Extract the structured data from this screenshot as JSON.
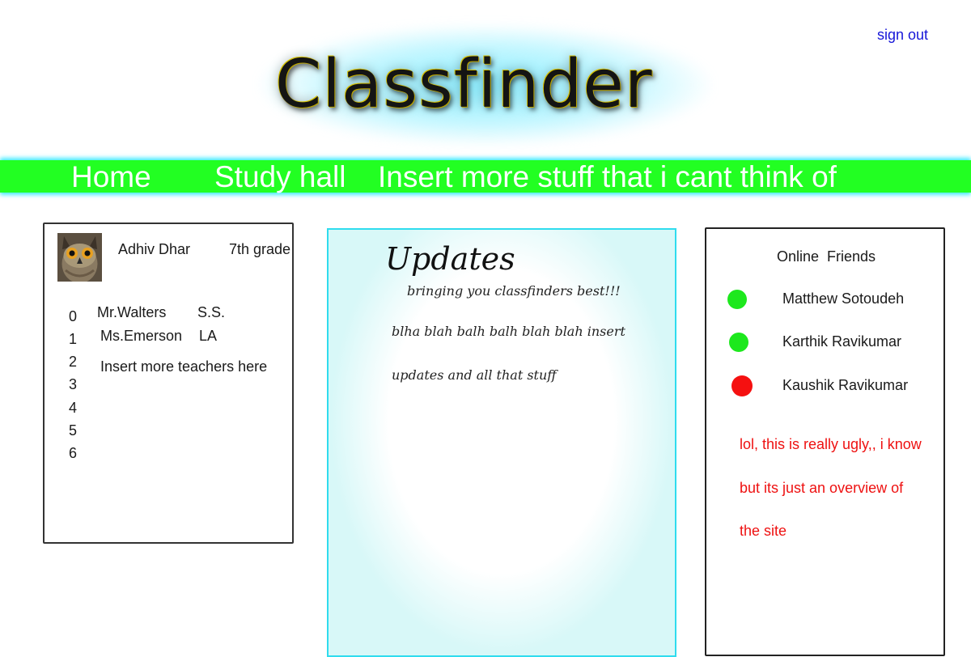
{
  "header": {
    "logo_text": "Classfinder",
    "sign_out_label": "sign out"
  },
  "nav": {
    "items": [
      "Home",
      "Study hall",
      "Insert more stuff that i cant think of"
    ]
  },
  "profile": {
    "avatar_icon": "owl-avatar-icon",
    "name": "Adhiv Dhar",
    "grade": "7th grade",
    "periods": [
      "0",
      "1",
      "2",
      "3",
      "4",
      "5",
      "6"
    ],
    "teachers": [
      {
        "name": "Mr.Walters",
        "subject": "S.S."
      },
      {
        "name": "Ms.Emerson",
        "subject": "LA"
      }
    ],
    "more_teachers": "Insert more teachers here"
  },
  "updates": {
    "title": "Updates",
    "subtitle": "bringing you classfinders best!!!",
    "line1": "blha blah balh balh blah blah insert",
    "line2": "updates and all that stuff"
  },
  "friends": {
    "title": "Online  Friends",
    "list": [
      {
        "name": "Matthew Sotoudeh",
        "status_color": "#1de81d"
      },
      {
        "name": "Karthik Ravikumar",
        "status_color": "#1de81d"
      },
      {
        "name": "Kaushik Ravikumar",
        "status_color": "#f51010"
      }
    ],
    "note_lines": [
      "lol, this is really ugly,, i know",
      "but its just an overview of",
      "the site"
    ]
  },
  "colors": {
    "nav_green": "#22ff22",
    "nav_glow": "#00e6ff",
    "link_blue": "#1515d8",
    "note_red": "#ee1111"
  }
}
